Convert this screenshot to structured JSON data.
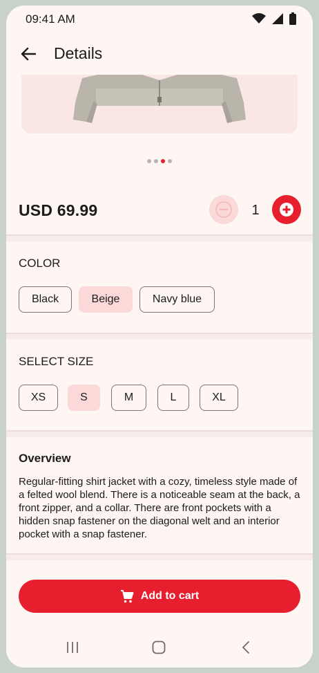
{
  "status": {
    "time": "09:41 AM"
  },
  "header": {
    "title": "Details"
  },
  "carousel": {
    "dots": 4,
    "active_index": 2
  },
  "product": {
    "price": "USD 69.99",
    "quantity": "1"
  },
  "color": {
    "label": "COLOR",
    "options": [
      "Black",
      "Beige",
      "Navy blue"
    ],
    "selected": "Beige"
  },
  "size": {
    "label": "SELECT SIZE",
    "options": [
      "XS",
      "S",
      "M",
      "L",
      "XL"
    ],
    "selected": "S"
  },
  "overview": {
    "title": "Overview",
    "text": "Regular-fitting shirt jacket with a cozy, timeless style made of a felted wool blend. There is a noticeable seam at the back, a front zipper, and a collar. There are front pockets with a hidden snap fastener on the diagonal welt and an interior pocket with a snap fastener."
  },
  "actions": {
    "add_to_cart": "Add to cart"
  },
  "icons": [
    "wifi-icon",
    "signal-icon",
    "battery-icon",
    "back-arrow-icon",
    "minus-icon",
    "plus-icon",
    "cart-icon",
    "recents-icon",
    "home-icon",
    "back-nav-icon"
  ],
  "colors": {
    "accent": "#e61e2d",
    "chip_selected": "#fcd9d9",
    "background": "#fdf6f3"
  }
}
